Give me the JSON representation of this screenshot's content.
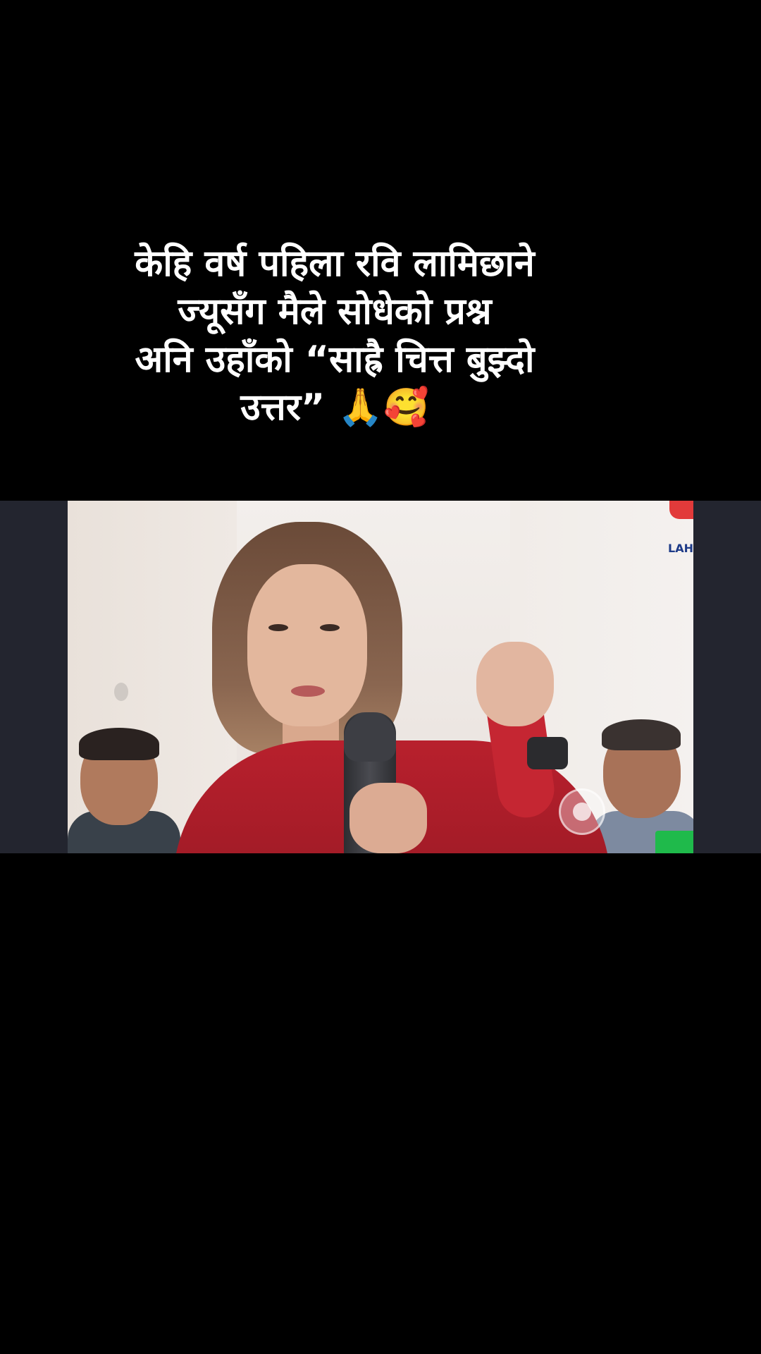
{
  "post": {
    "caption_lines": [
      "केहि वर्ष पहिला रवि लामिछाने",
      "ज्यूसँग मैले सोधेको प्रश्न",
      "अनि उहाँको “साह्रै चित्त बुझ्दो",
      "उत्तर” 🙏🥰"
    ]
  },
  "video": {
    "brand_text": "LAH"
  },
  "colors": {
    "background": "#000000",
    "video_band": "#23252f",
    "caption_text": "#ffffff"
  }
}
